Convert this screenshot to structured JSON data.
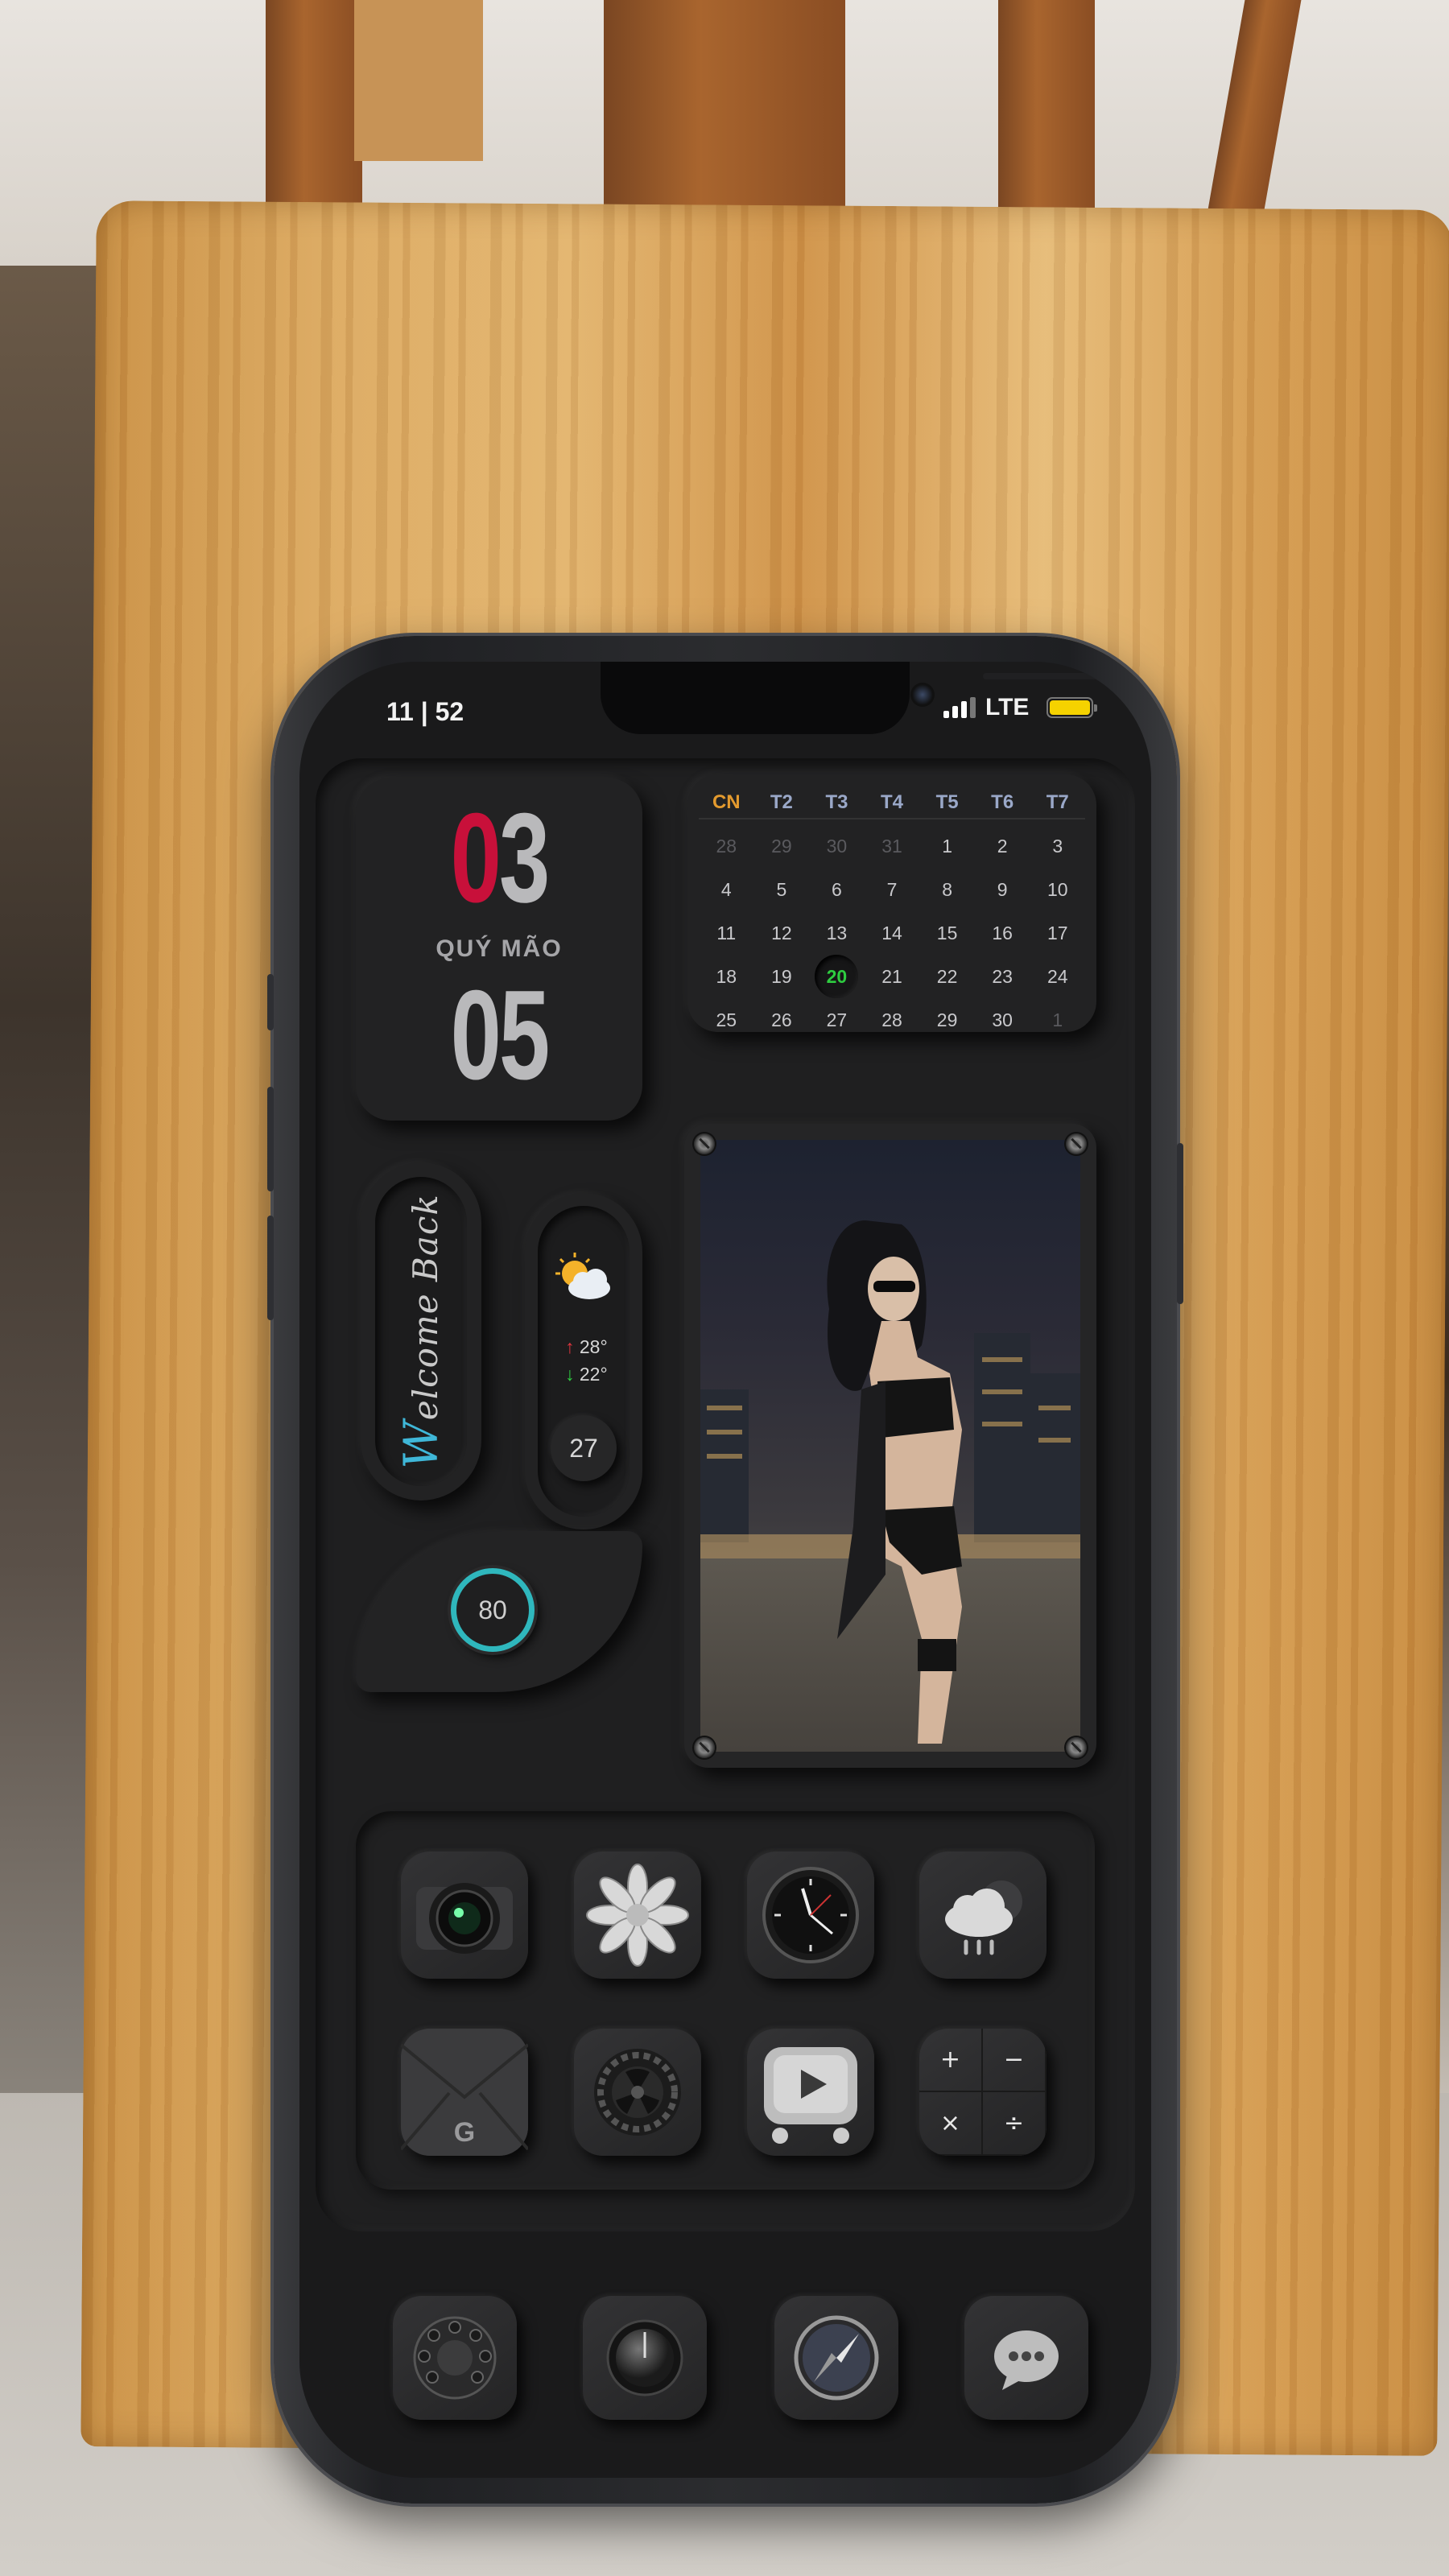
{
  "status": {
    "time": "11 | 52",
    "network": "LTE"
  },
  "date_widget": {
    "day_prefix": "0",
    "day_suffix": "3",
    "lunar_year": "QUÝ MÃO",
    "month": "05"
  },
  "calendar": {
    "weekdays": [
      "CN",
      "T2",
      "T3",
      "T4",
      "T5",
      "T6",
      "T7"
    ],
    "weeks": [
      [
        "28",
        "29",
        "30",
        "31",
        "1",
        "2",
        "3"
      ],
      [
        "4",
        "5",
        "6",
        "7",
        "8",
        "9",
        "10"
      ],
      [
        "11",
        "12",
        "13",
        "14",
        "15",
        "16",
        "17"
      ],
      [
        "18",
        "19",
        "20",
        "21",
        "22",
        "23",
        "24"
      ],
      [
        "25",
        "26",
        "27",
        "28",
        "29",
        "30",
        "1"
      ]
    ],
    "today": "20"
  },
  "welcome": {
    "first": "W",
    "rest": "elcome Back"
  },
  "weather": {
    "high": "28°",
    "low": "22°",
    "day": "27",
    "icon": "partly-cloudy-icon"
  },
  "battery_ring": {
    "value": "80",
    "accent": "#2fb7bd"
  },
  "apps": [
    {
      "name": "camera-icon"
    },
    {
      "name": "photos-icon"
    },
    {
      "name": "clock-icon"
    },
    {
      "name": "weather-icon"
    },
    {
      "name": "mail-icon"
    },
    {
      "name": "settings-icon"
    },
    {
      "name": "youtube-icon"
    },
    {
      "name": "calculator-icon"
    }
  ],
  "dock": [
    {
      "name": "phone-icon"
    },
    {
      "name": "music-icon"
    },
    {
      "name": "safari-icon"
    },
    {
      "name": "messages-icon"
    }
  ],
  "calculator_symbols": [
    "+",
    "−",
    "×",
    "÷"
  ],
  "colors": {
    "accent_red": "#c8103a",
    "today_green": "#2ecc40",
    "battery_yellow": "#f5d200"
  }
}
